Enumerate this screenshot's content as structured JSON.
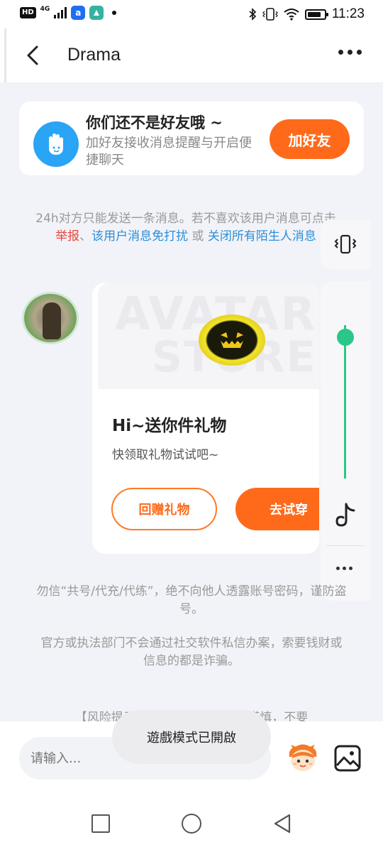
{
  "status_bar": {
    "hd": "HD",
    "network": "4G",
    "app_icon_1": "a",
    "time": "11:23",
    "icons": [
      "bluetooth-icon",
      "vibrate-icon",
      "wifi-icon",
      "battery-charging-icon"
    ]
  },
  "header": {
    "title": "Drama",
    "back_icon": "chevron-left-icon",
    "more_icon": "more-dots-icon"
  },
  "friend_card": {
    "title": "你们还不是好友哦 ~",
    "subtitle": "加好友接收消息提醒与开启便捷聊天",
    "add_button": "加好友",
    "icon": "hand-wave-icon"
  },
  "notice": {
    "text_1": "24h对方只能发送一条消息。若不喜欢该用户消息可点击 ",
    "report": "举报",
    "sep": "、",
    "mute_user": "该用户消息免打扰",
    "or": " 或 ",
    "close_all": "关闭所有陌生人消息"
  },
  "gift_card": {
    "watermark_1": "AVATAR",
    "watermark_2": "STORE",
    "title": "Hi~送你件礼物",
    "subtitle": "快领取礼物试试吧~",
    "return_button": "回赠礼物",
    "try_button": "去试穿"
  },
  "side_panel": {
    "vibrate_icon": "vibrate-icon",
    "volume_level": 0.92,
    "tiktok_icon": "tiktok-icon",
    "more_icon": "more-dots-icon"
  },
  "warnings": {
    "line_1": "勿信“共号/代充/代练”，绝不向他人透露账号密码，谨防盗号。",
    "line_2": "官方或执法部门不会通过社交软件私信办案，索要钱财或信息的都是诈骗。",
    "line_3": "【风险提示】 对方是陌生人，请谨慎，不要"
  },
  "input_bar": {
    "placeholder": "请输入...",
    "emoji_icon": "emoji-avatar-icon",
    "image_icon": "image-icon"
  },
  "toast": {
    "text": "遊戲模式已開啟"
  },
  "nav_bar": {
    "icons": [
      "recent-apps-icon",
      "home-icon",
      "back-icon"
    ]
  },
  "colors": {
    "accent": "#ff6a1a",
    "link_blue": "#2a8ed8",
    "link_red": "#e8453c",
    "volume_green": "#2bc68a",
    "background": "#f2f3f8"
  }
}
